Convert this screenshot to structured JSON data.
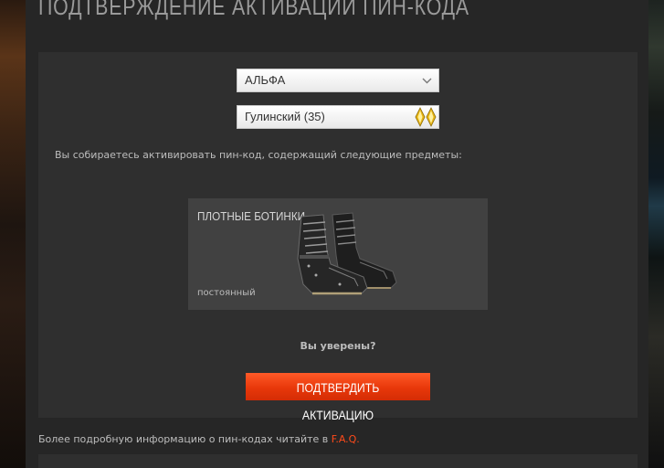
{
  "page": {
    "title": "ПОДТВЕРЖДЕНИЕ АКТИВАЦИИ ПИН-КОДА"
  },
  "form": {
    "server_select": {
      "value": "АЛЬФА",
      "icon": "chevron-down-icon"
    },
    "character_select": {
      "value": "Гулинский (35)",
      "icon": "rank-insignia-icon"
    },
    "info_text": "Вы собираетесь активировать пин-код, содержащий следующие предметы:"
  },
  "item": {
    "name": "ПЛОТНЫЕ БОТИНКИ",
    "duration": "постоянный",
    "image": "combat-boots-image"
  },
  "confirm": {
    "question": "Вы уверены?",
    "button_label": "ПОДТВЕРДИТЬ АКТИВАЦИЮ",
    "button_color": "#f0400f"
  },
  "footer": {
    "text": "Более подробную информацию о пин-кодах читайте в ",
    "link_text": "F.A.Q.",
    "link_suffix": ".",
    "link_color": "#ff4a1a"
  }
}
